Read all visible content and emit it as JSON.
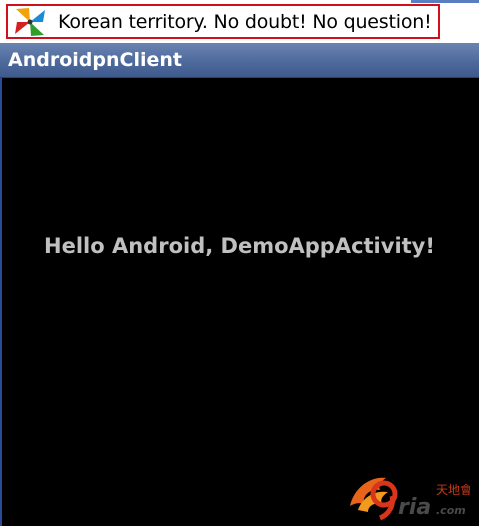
{
  "notification": {
    "icon": "pinwheel-app-icon",
    "text": "Korean territory. No doubt! No question!"
  },
  "app": {
    "title": "AndroidpnClient"
  },
  "content": {
    "hello": "Hello Android, DemoAppActivity!"
  },
  "watermark": {
    "icon": "ria-logo-watermark"
  },
  "colors": {
    "title_bar": "#4e6a9c",
    "notification_border": "#d0101a",
    "content_bg": "#000000",
    "hello_text": "#c0c0c0"
  }
}
